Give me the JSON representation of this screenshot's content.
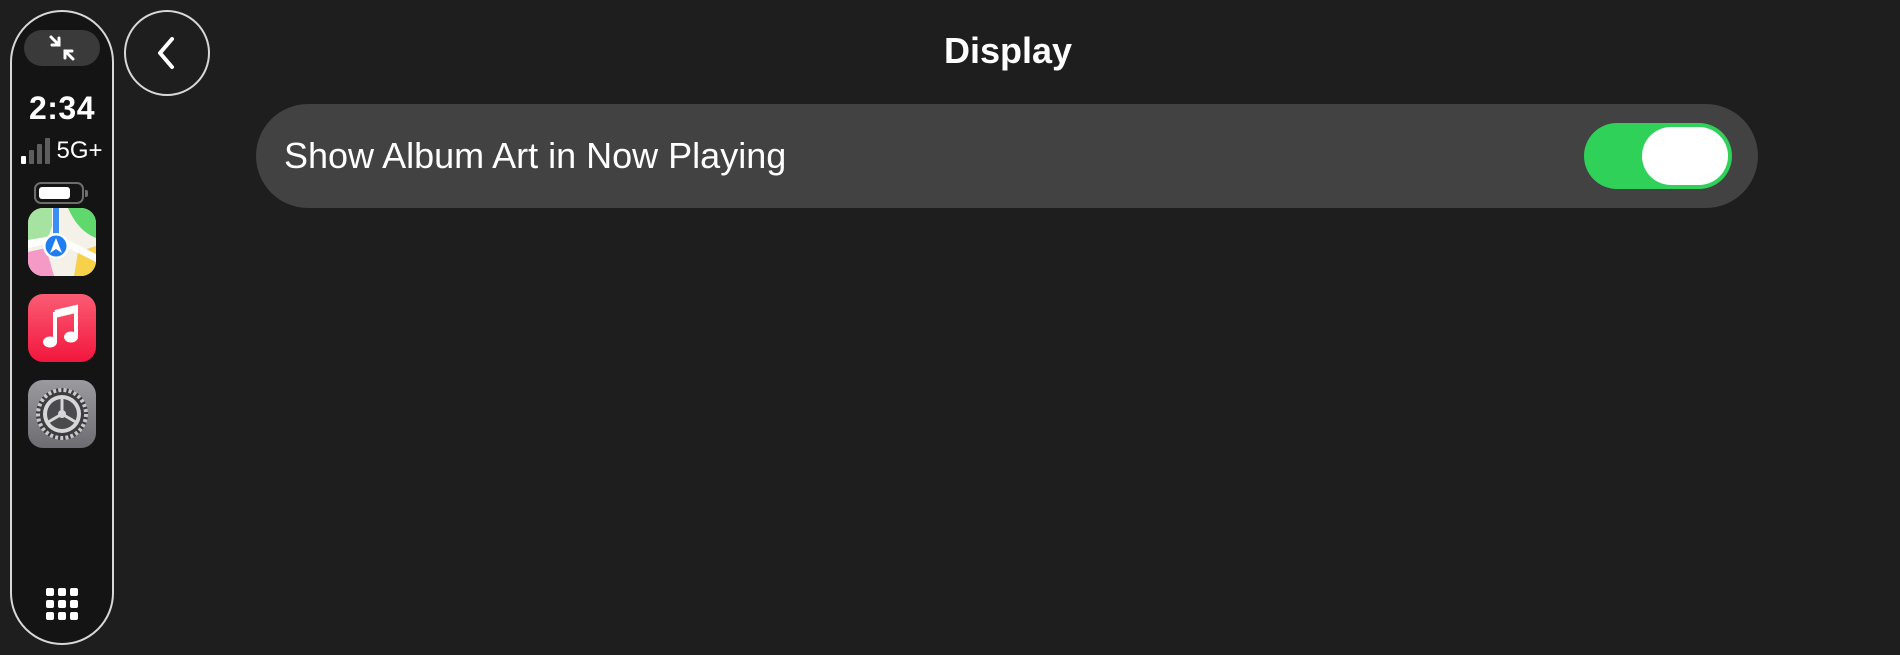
{
  "status": {
    "time": "2:34",
    "network": "5G+",
    "signal_bars_active": 1,
    "signal_bars_total": 4,
    "battery_level": 0.78
  },
  "sidebar": {
    "minimize_icon": "minimize-arrows-icon",
    "apps": [
      {
        "name": "Maps",
        "icon": "maps-app-icon"
      },
      {
        "name": "Music",
        "icon": "music-app-icon"
      },
      {
        "name": "Settings",
        "icon": "settings-app-icon"
      }
    ],
    "app_grid_icon": "app-grid-icon"
  },
  "header": {
    "title": "Display",
    "back_icon": "chevron-left-icon"
  },
  "settings": [
    {
      "label": "Show Album Art in Now Playing",
      "enabled": true
    }
  ],
  "colors": {
    "background": "#1e1e1e",
    "row_background": "#424242",
    "toggle_on": "#30d158"
  }
}
